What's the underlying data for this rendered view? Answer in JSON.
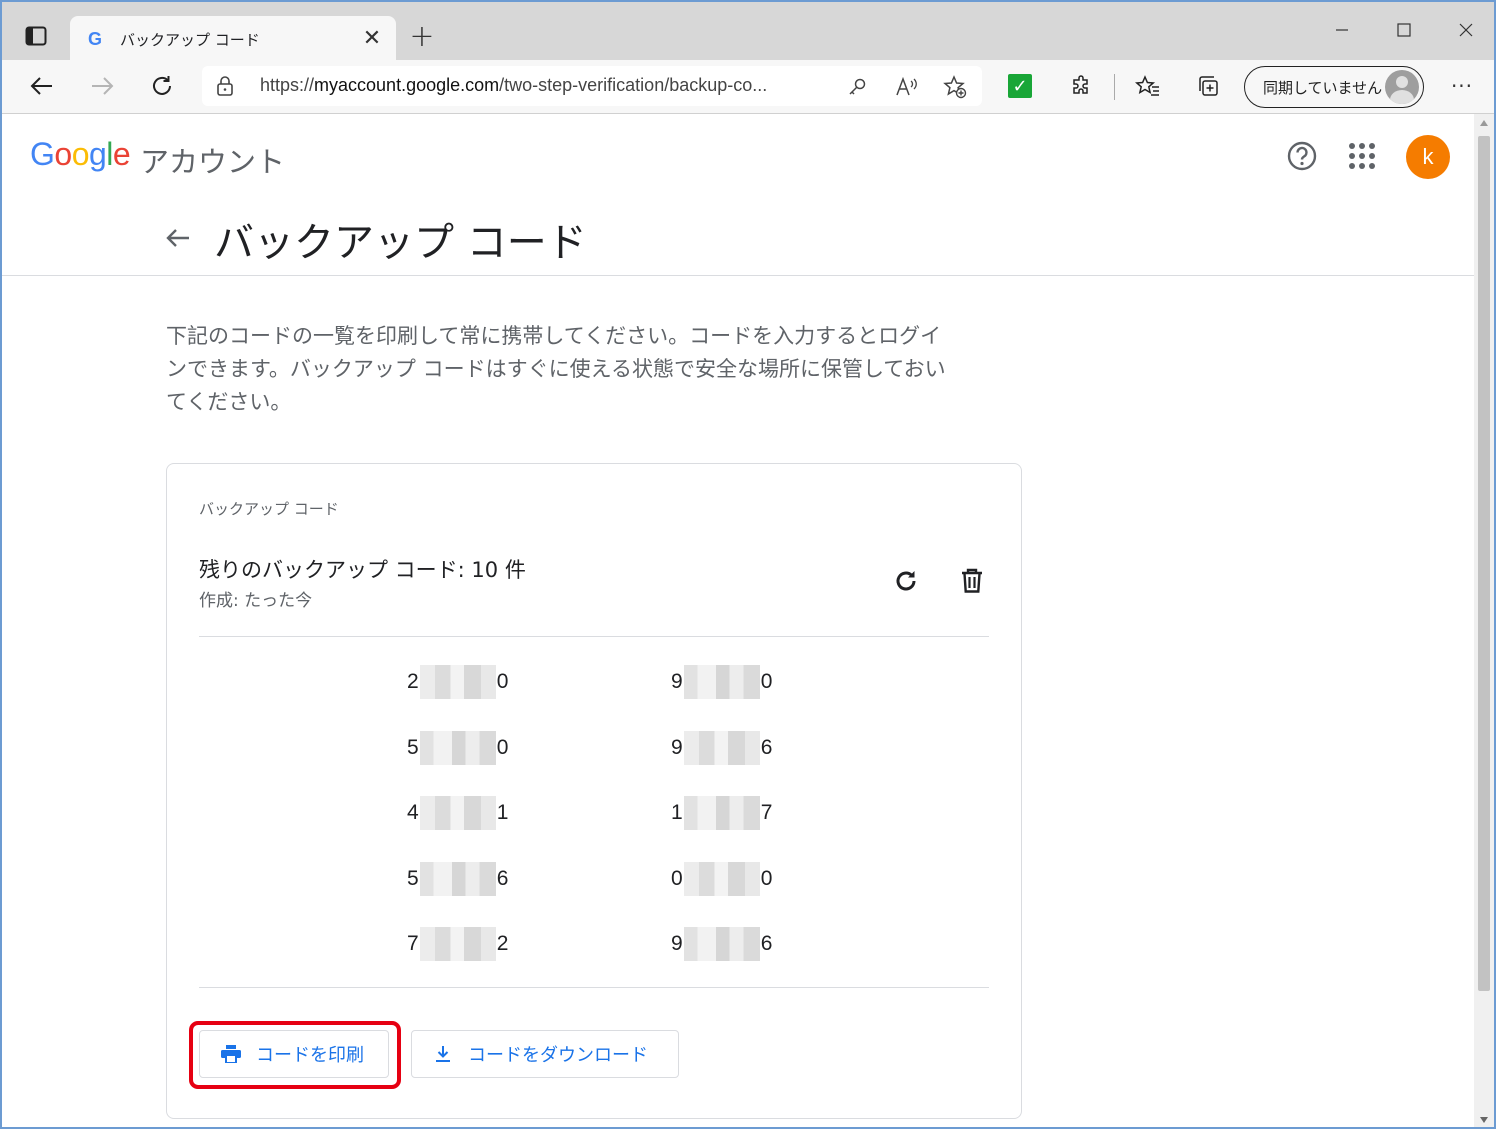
{
  "browser": {
    "tab_title": "バックアップ コード",
    "tab_favicon": "G",
    "new_tab_label": "+",
    "tab_close_label": "✕",
    "url_scheme": "https://",
    "url_host": "myaccount.google.com",
    "url_path": "/two-step-verification/backup-co...",
    "profile_label": "同期していません",
    "more_label": "···",
    "icons": [
      "tab-actions-icon",
      "back-icon",
      "forward-icon",
      "refresh-icon",
      "lock-icon",
      "key-icon",
      "read-aloud-icon",
      "add-favorite-icon",
      "extension-check-icon",
      "extensions-icon",
      "favorites-icon",
      "collections-icon",
      "more-icon",
      "minimize-icon",
      "maximize-icon",
      "close-icon"
    ]
  },
  "header": {
    "logo_letters": [
      "G",
      "o",
      "o",
      "g",
      "l",
      "e"
    ],
    "product": "アカウント",
    "avatar_letter": "k",
    "colors": {
      "blue": "#4285f4",
      "red": "#ea4335",
      "yellow": "#fbbc05",
      "green": "#34a853",
      "avatar": "#f57c00"
    }
  },
  "page": {
    "title": "バックアップ コード",
    "description": "下記のコードの一覧を印刷して常に携帯してください。コードを入力するとログインできます。バックアップ コードはすぐに使える状態で安全な場所に保管しておいてください。"
  },
  "card": {
    "label": "バックアップ コード",
    "remaining": "残りのバックアップ コード: 10 件",
    "created": "作成: たった今",
    "codes": [
      {
        "first": "2",
        "last": "0"
      },
      {
        "first": "9",
        "last": "0"
      },
      {
        "first": "5",
        "last": "0"
      },
      {
        "first": "9",
        "last": "6"
      },
      {
        "first": "4",
        "last": "1"
      },
      {
        "first": "1",
        "last": "7"
      },
      {
        "first": "5",
        "last": "6"
      },
      {
        "first": "0",
        "last": "0"
      },
      {
        "first": "7",
        "last": "2"
      },
      {
        "first": "9",
        "last": "6"
      }
    ],
    "print_label": "コードを印刷",
    "download_label": "コードをダウンロード",
    "accent_color": "#1a73e8",
    "highlight_color": "#e60012"
  }
}
